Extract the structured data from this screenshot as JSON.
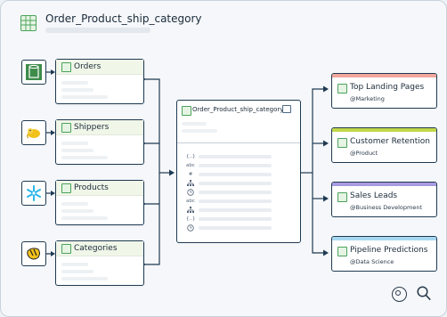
{
  "header": {
    "title": "Order_Product_ship_category"
  },
  "sources": [
    {
      "name": "Orders",
      "icon": "aws-redshift-icon",
      "color": "#3d8c4a"
    },
    {
      "name": "Shippers",
      "icon": "hadoop-elephant-icon",
      "color": "#f2c21b"
    },
    {
      "name": "Products",
      "icon": "snowflake-icon",
      "color": "#29b5e8"
    },
    {
      "name": "Categories",
      "icon": "hive-bee-icon",
      "color": "#f4c21a"
    }
  ],
  "main_table": {
    "name": "Order_Product_ship_category",
    "fields": [
      {
        "type_icon": "{..}"
      },
      {
        "type_icon": "abc"
      },
      {
        "type_icon": "#"
      },
      {
        "type_icon": "hierarchy-icon"
      },
      {
        "type_icon": "clock-icon"
      },
      {
        "type_icon": "abc"
      },
      {
        "type_icon": "hierarchy-icon"
      },
      {
        "type_icon": "{..}"
      },
      {
        "type_icon": "clock-icon"
      }
    ]
  },
  "outputs": [
    {
      "title": "Top Landing Pages",
      "owner": "@Marketing",
      "color": "#f2a79b"
    },
    {
      "title": "Customer Retention",
      "owner": "@Product",
      "color": "#c2d848"
    },
    {
      "title": "Sales Leads",
      "owner": "@Business Development",
      "color": "#a99be0"
    },
    {
      "title": "Pipeline Predictions",
      "owner": "@Data Science",
      "color": "#a8d8f0"
    }
  ],
  "toolbar": {
    "focus_icon": "target-icon",
    "search_icon": "search-icon"
  }
}
